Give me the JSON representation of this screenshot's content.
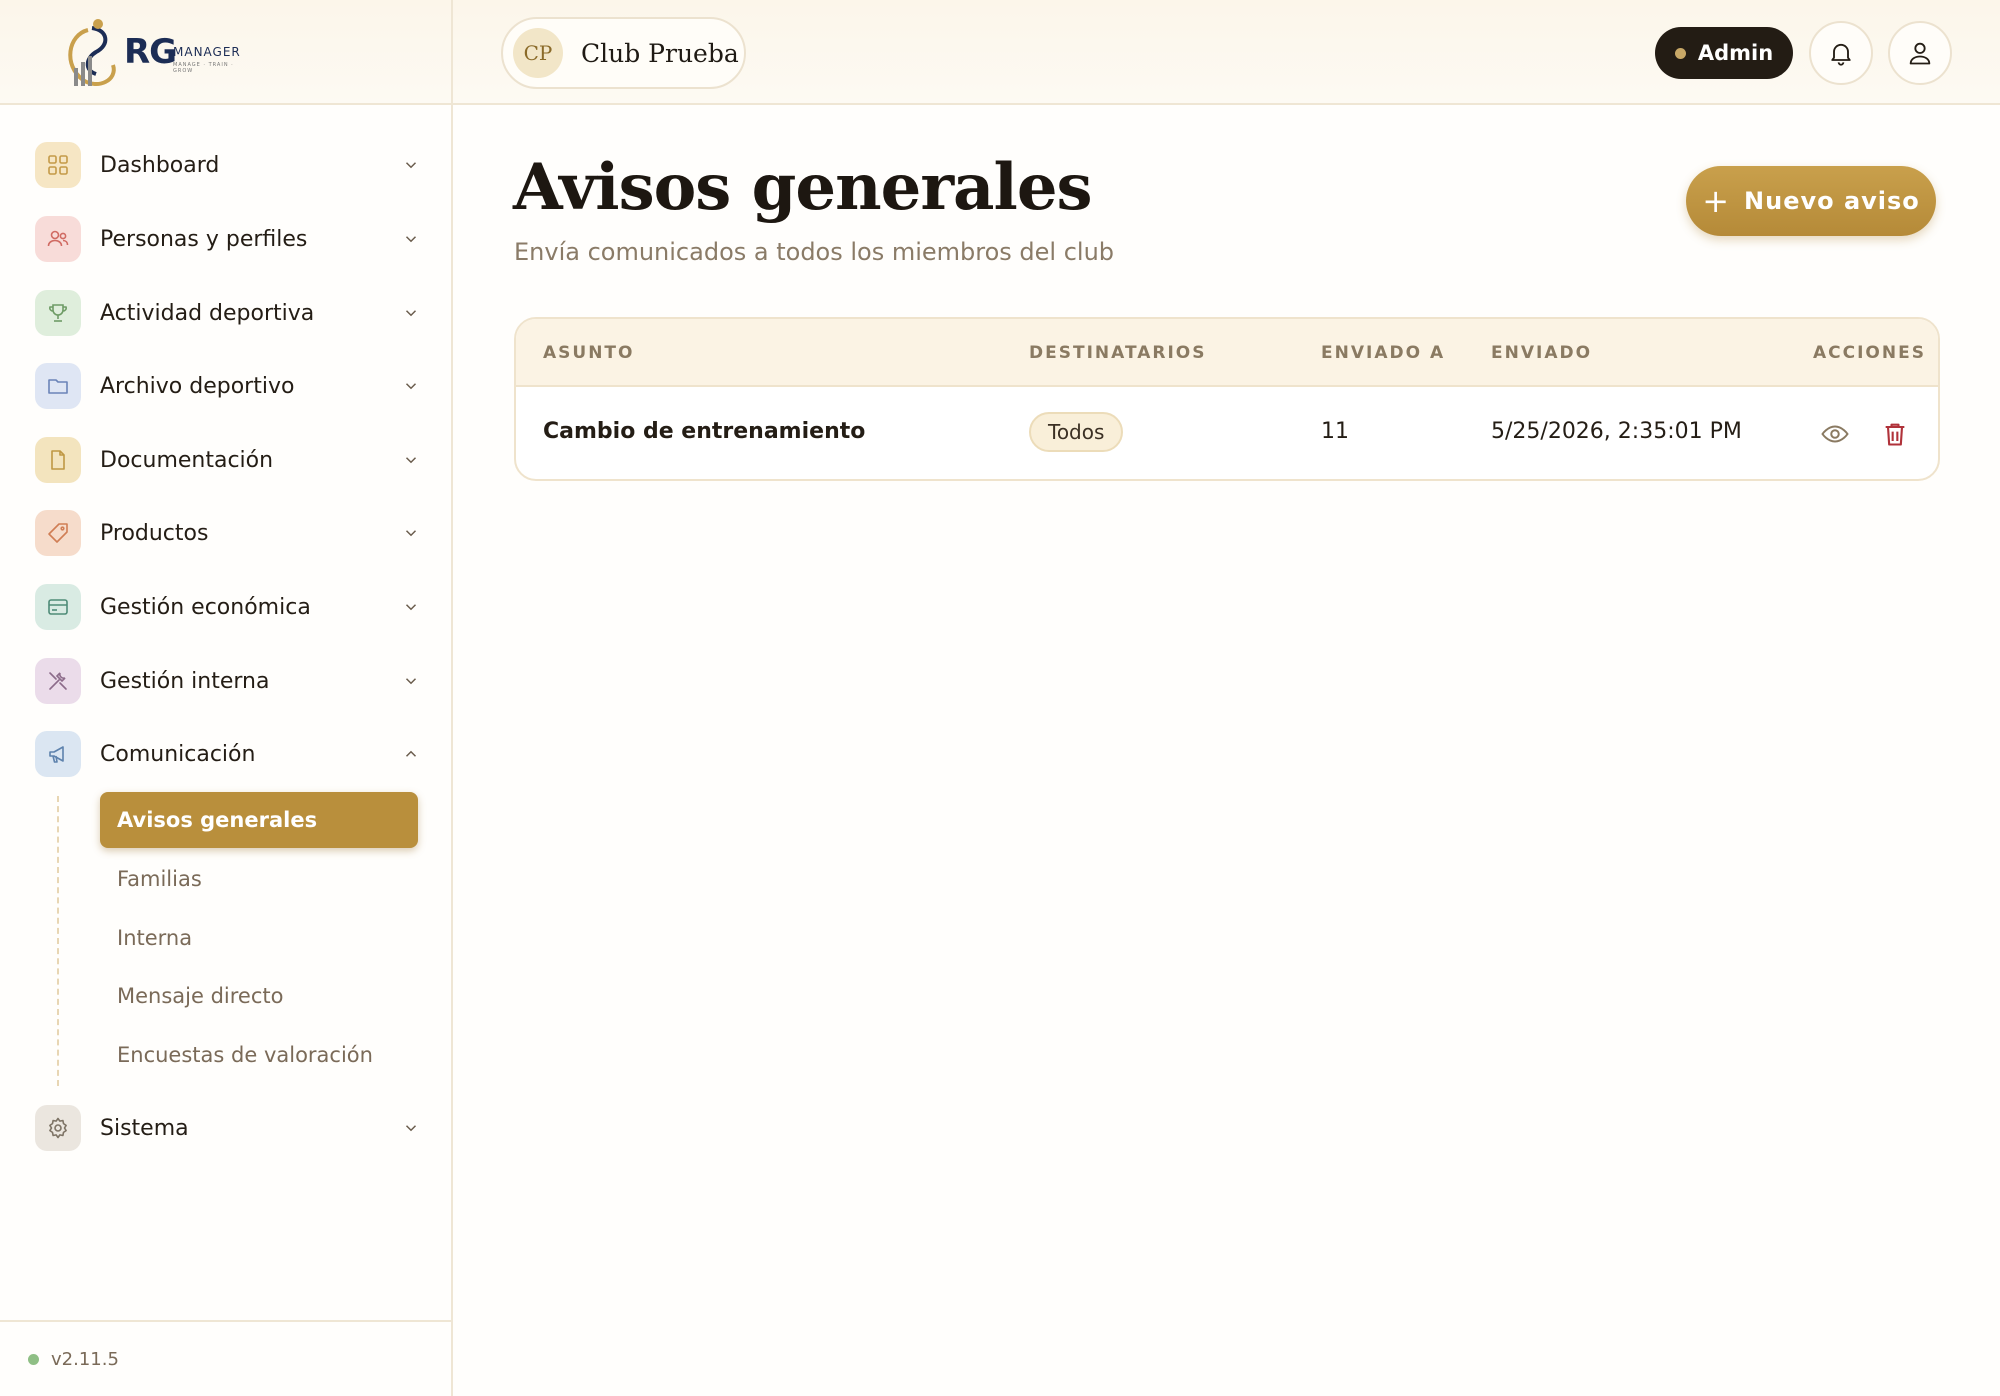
{
  "header": {
    "logo": {
      "brand": "RG",
      "product": "MANAGER",
      "tagline": "MANAGE · TRAIN · GROW"
    },
    "club": {
      "initials": "CP",
      "name": "Club Prueba"
    },
    "role_badge": "Admin"
  },
  "sidebar": {
    "items": [
      {
        "label": "Dashboard",
        "icon": "grid-icon",
        "color": "#f6e6c4",
        "expanded": false
      },
      {
        "label": "Personas y perfiles",
        "icon": "users-icon",
        "color": "#f8dcd9",
        "expanded": false
      },
      {
        "label": "Actividad deportiva",
        "icon": "trophy-icon",
        "color": "#dfeedc",
        "expanded": false
      },
      {
        "label": "Archivo deportivo",
        "icon": "folder-icon",
        "color": "#dfe6f4",
        "expanded": false
      },
      {
        "label": "Documentación",
        "icon": "document-icon",
        "color": "#f3e4be",
        "expanded": false
      },
      {
        "label": "Productos",
        "icon": "tag-icon",
        "color": "#f6dccb",
        "expanded": false
      },
      {
        "label": "Gestión económica",
        "icon": "card-icon",
        "color": "#d9ebe3",
        "expanded": false
      },
      {
        "label": "Gestión interna",
        "icon": "tools-icon",
        "color": "#ebdcea",
        "expanded": false
      },
      {
        "label": "Comunicación",
        "icon": "megaphone-icon",
        "color": "#dbe6f2",
        "expanded": true
      },
      {
        "label": "Sistema",
        "icon": "gear-icon",
        "color": "#ebe6df",
        "expanded": false
      }
    ],
    "sub_items": [
      {
        "label": "Avisos generales",
        "active": true
      },
      {
        "label": "Familias",
        "active": false
      },
      {
        "label": "Interna",
        "active": false
      },
      {
        "label": "Mensaje directo",
        "active": false
      },
      {
        "label": "Encuestas de valoración",
        "active": false
      }
    ],
    "version": "v2.11.5"
  },
  "main": {
    "title": "Avisos generales",
    "subtitle": "Envía comunicados a todos los miembros del club",
    "new_button": "Nuevo aviso",
    "table": {
      "columns": [
        "ASUNTO",
        "DESTINATARIOS",
        "ENVIADO A",
        "ENVIADO",
        "ACCIONES"
      ],
      "rows": [
        {
          "subject": "Cambio de entrenamiento",
          "recipients": "Todos",
          "sent_to": "11",
          "sent": "5/25/2026, 2:35:01 PM"
        }
      ]
    }
  },
  "colors": {
    "accent": "#b98f3c",
    "dark": "#231c14",
    "delete": "#b0323a"
  }
}
